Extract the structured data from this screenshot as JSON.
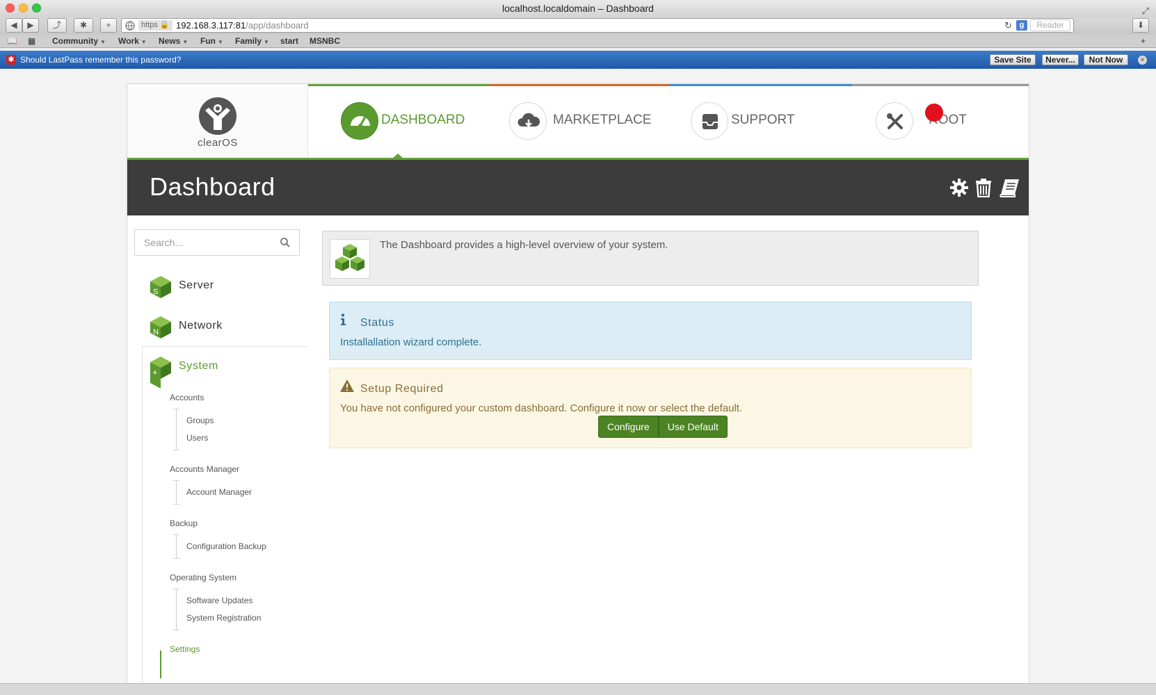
{
  "browser": {
    "window_title": "localhost.localdomain – Dashboard",
    "url_scheme": "https",
    "url_host": "192.168.3.117:81",
    "url_path": "/app/dashboard",
    "reader_label": "Reader",
    "bookmarks": [
      {
        "label": "Community",
        "menu": true
      },
      {
        "label": "Work",
        "menu": true
      },
      {
        "label": "News",
        "menu": true
      },
      {
        "label": "Fun",
        "menu": true
      },
      {
        "label": "Family",
        "menu": true
      },
      {
        "label": "start",
        "menu": false
      },
      {
        "label": "MSNBC",
        "menu": false
      }
    ]
  },
  "lastpass": {
    "prompt": "Should LastPass remember this password?",
    "save_site": "Save Site",
    "never": "Never...",
    "not_now": "Not Now"
  },
  "brand": {
    "logo_text": "clearOS",
    "accent_color": "#5b9a2f"
  },
  "nav": {
    "items": [
      {
        "label": "DASHBOARD",
        "icon": "speedometer-icon",
        "active": true
      },
      {
        "label": "MARKETPLACE",
        "icon": "cloud-download-icon",
        "active": false
      },
      {
        "label": "SUPPORT",
        "icon": "inbox-icon",
        "active": false
      },
      {
        "label": "ROOT",
        "icon": "tools-icon",
        "active": false
      }
    ]
  },
  "header": {
    "title": "Dashboard",
    "icons": [
      "gear-icon",
      "trash-icon",
      "book-icon"
    ]
  },
  "sidebar": {
    "search_placeholder": "Search...",
    "categories": [
      {
        "label": "Server",
        "letter": "S"
      },
      {
        "label": "Network",
        "letter": "N"
      },
      {
        "label": "System",
        "letter": "+"
      }
    ],
    "sections": [
      {
        "label": "Accounts",
        "items": [
          "Groups",
          "Users"
        ]
      },
      {
        "label": "Accounts Manager",
        "items": [
          "Account Manager"
        ]
      },
      {
        "label": "Backup",
        "items": [
          "Configuration Backup"
        ]
      },
      {
        "label": "Operating System",
        "items": [
          "Software Updates",
          "System Registration"
        ]
      },
      {
        "label": "Settings",
        "items": []
      }
    ]
  },
  "main": {
    "intro": "The Dashboard provides a high-level overview of your system.",
    "status": {
      "title": "Status",
      "message": "Installallation wizard complete."
    },
    "setup": {
      "title": "Setup Required",
      "message": "You have not configured your custom dashboard. Configure it now or select the default.",
      "configure_label": "Configure",
      "default_label": "Use Default"
    }
  }
}
